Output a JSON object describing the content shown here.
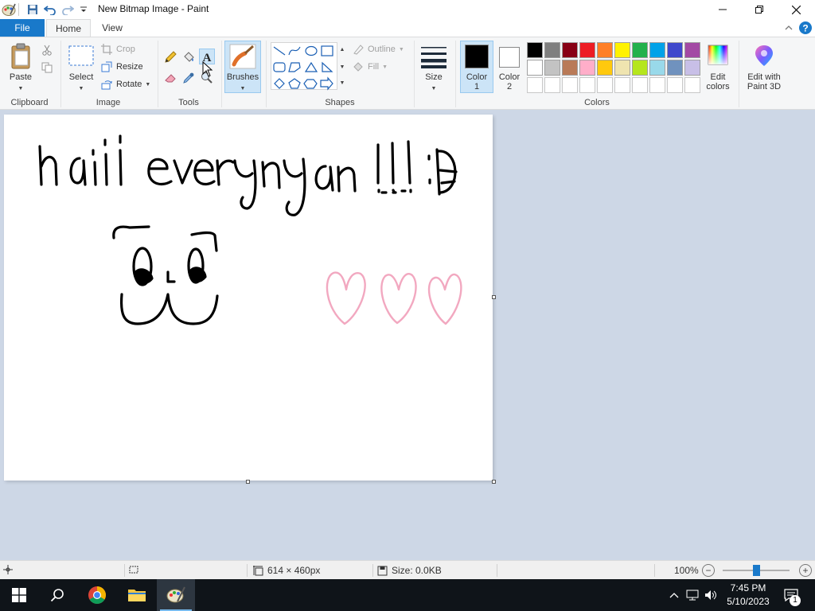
{
  "window": {
    "title": "New Bitmap Image - Paint"
  },
  "tabs": {
    "file": "File",
    "home": "Home",
    "view": "View"
  },
  "clipboard": {
    "paste": "Paste",
    "group": "Clipboard"
  },
  "image": {
    "select": "Select",
    "crop": "Crop",
    "resize": "Resize",
    "rotate": "Rotate",
    "group": "Image"
  },
  "tools": {
    "group": "Tools"
  },
  "brushes": {
    "label": "Brushes"
  },
  "shapes": {
    "outline": "Outline",
    "fill": "Fill",
    "group": "Shapes"
  },
  "size": {
    "label": "Size"
  },
  "colors": {
    "color1_label": "Color",
    "color1_num": "1",
    "color2_label": "Color",
    "color2_num": "2",
    "edit_colors_1": "Edit",
    "edit_colors_2": "colors",
    "group": "Colors",
    "color1": "#000000",
    "color2": "#ffffff",
    "palette_row1": [
      "#000000",
      "#7f7f7f",
      "#880015",
      "#ed1c24",
      "#ff7f27",
      "#fff200",
      "#22b14c",
      "#00a2e8",
      "#3f48cc",
      "#a349a4"
    ],
    "palette_row2": [
      "#ffffff",
      "#c3c3c3",
      "#b97a57",
      "#ffaec9",
      "#ffc90e",
      "#efe4b0",
      "#b5e61d",
      "#99d9ea",
      "#7092be",
      "#c8bfe7"
    ],
    "palette_row3": [
      "#ffffff",
      "#ffffff",
      "#ffffff",
      "#ffffff",
      "#ffffff",
      "#ffffff",
      "#ffffff",
      "#ffffff",
      "#ffffff",
      "#ffffff"
    ]
  },
  "paint3d": {
    "line1": "Edit with",
    "line2": "Paint 3D"
  },
  "status": {
    "dimensions": "614 × 460px",
    "size": "Size: 0.0KB",
    "zoom": "100%"
  },
  "taskbar": {
    "time": "7:45 PM",
    "date": "5/10/2023",
    "notifications": "1"
  }
}
